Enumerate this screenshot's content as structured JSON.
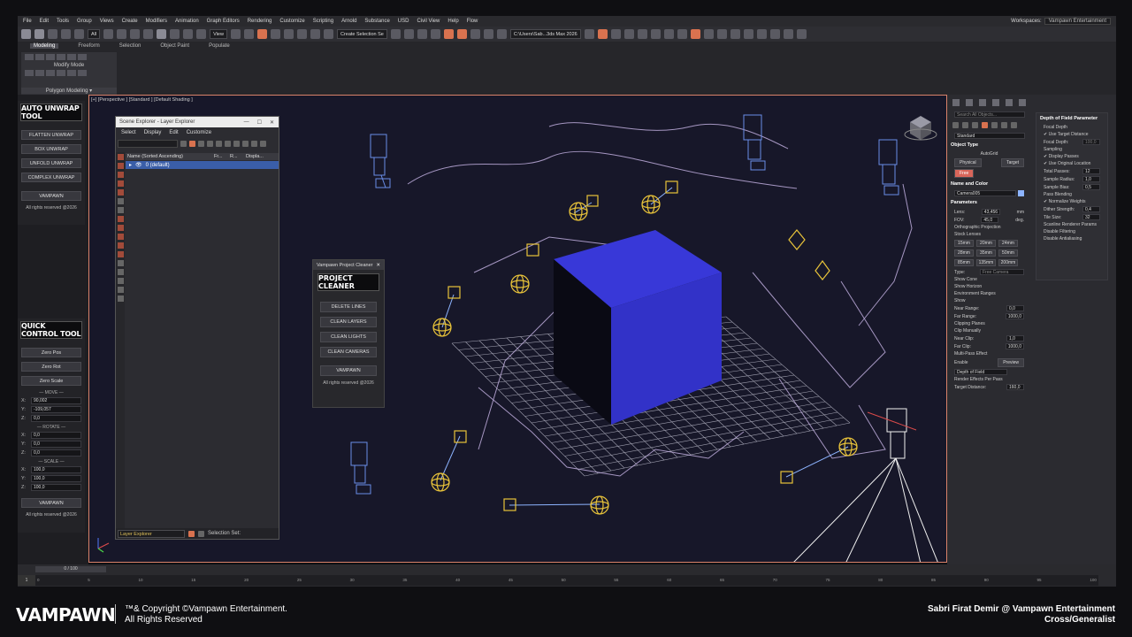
{
  "menubar": {
    "items": [
      "File",
      "Edit",
      "Tools",
      "Group",
      "Views",
      "Create",
      "Modifiers",
      "Animation",
      "Graph Editors",
      "Rendering",
      "Customize",
      "Scripting",
      "Arnold",
      "Substance",
      "USD",
      "Civil View",
      "Help",
      "Flow"
    ],
    "workspace_label": "Workspaces:",
    "workspace_value": "Vampawn Entertainment"
  },
  "toolbar": {
    "filter_value": "All",
    "view_value": "View",
    "selection_set_placeholder": "Create Selection Se",
    "path_value": "C:\\Users\\Sab...3ds Max 2026"
  },
  "ribbon": {
    "tabs": [
      "Modeling",
      "Freeform",
      "Selection",
      "Object Paint",
      "Populate"
    ],
    "modify_mode": "Modify Mode",
    "polygon_modeling": "Polygon Modeling"
  },
  "auto_unwrap": {
    "title": "AUTO UNWRAP TOOL",
    "buttons": [
      "FLATTEN UNWRAP",
      "BOX UNWRAP",
      "UNFOLD UNWRAP",
      "COMPLEX UNWRAP"
    ],
    "brand_button": "VAMPAWN",
    "note": "All rights reserved @2026"
  },
  "quick_control": {
    "title": "QUICK CONTROL TOOL",
    "buttons": [
      "Zero Pos",
      "Zero Rot",
      "Zero Scale"
    ],
    "move_label": "MOVE",
    "move": {
      "x": "90,002",
      "y": "-109,057",
      "z": "0,0"
    },
    "rotate_label": "ROTATE",
    "rotate": {
      "x": "0,0",
      "y": "0,0",
      "z": "0,0"
    },
    "scale_label": "SCALE",
    "scale": {
      "x": "100,0",
      "y": "100,0",
      "z": "100,0"
    },
    "brand_button": "VAMPAWN",
    "note": "All rights reserved @2026",
    "axis_x": "X:",
    "axis_y": "Y:",
    "axis_z": "Z:"
  },
  "viewport": {
    "label": "[+] [Perspective ] [Standard ] [Default Shading ]"
  },
  "scene_explorer": {
    "title": "Scene Explorer - Layer Explorer",
    "menu": [
      "Select",
      "Display",
      "Edit",
      "Customize"
    ],
    "columns": [
      "Name (Sorted Ascending)",
      "Fr...",
      "R...",
      "Displa..."
    ],
    "row": "0 (default)",
    "bottom_dropdown": "Layer Explorer",
    "selection_set": "Selection Set:"
  },
  "project_cleaner": {
    "window_title": "Vampawn Project Cleaner",
    "title": "PROJECT CLEANER",
    "buttons": [
      "DELETE LINES",
      "CLEAN LAYERS",
      "CLEAN LIGHTS",
      "CLEAN CAMERAS"
    ],
    "brand_button": "VAMPAWN",
    "note": "All rights reserved @2026"
  },
  "command_panel": {
    "search_placeholder": "Search All Objects...",
    "category": "Standard",
    "object_type": "Object Type",
    "autogrid": "AutoGrid",
    "physical": "Physical",
    "target": "Target",
    "free": "Free",
    "name_and_color": "Name and Color",
    "name_value": "Camera005",
    "parameters": "Parameters",
    "lens_label": "Lens:",
    "lens_value": "43,456",
    "lens_unit": "mm",
    "fov_label": "FOV:",
    "fov_value": "45,0",
    "fov_unit": "deg.",
    "ortho": "Orthographic Projection",
    "stock_lenses": "Stock Lenses",
    "lenses": [
      "15mm",
      "20mm",
      "24mm",
      "28mm",
      "35mm",
      "50mm",
      "85mm",
      "135mm",
      "200mm"
    ],
    "type_label": "Type:",
    "type_value": "Free Camera",
    "show_cone": "Show Cone",
    "show_horizon": "Show Horizon",
    "env_ranges": "Environment Ranges",
    "show": "Show",
    "near_range_label": "Near Range:",
    "near_range": "0,0",
    "far_range_label": "Far Range:",
    "far_range": "1000,0",
    "clipping": "Clipping Planes",
    "clip_manually": "Clip Manually",
    "near_clip_label": "Near Clip:",
    "near_clip": "1,0",
    "far_clip_label": "Far Clip:",
    "far_clip": "1000,0",
    "multipass": "Multi-Pass Effect",
    "enable": "Enable",
    "preview": "Preview",
    "effect_value": "Depth of Field",
    "render_effects": "Render Effects Per Pass",
    "target_distance_label": "Target Distance:",
    "target_distance": "160,0"
  },
  "dof": {
    "title": "Depth of Field Parameter",
    "focal_depth": "Focal Depth",
    "use_target": "Use Target Distance",
    "focal_depth_label": "Focal Depth:",
    "focal_depth_value": "100,0",
    "sampling": "Sampling",
    "display_passes": "Display Passes",
    "use_original": "Use Original Location",
    "total_passes_label": "Total Passes:",
    "total_passes": "12",
    "sample_radius_label": "Sample Radius:",
    "sample_radius": "1,0",
    "sample_bias_label": "Sample Bias:",
    "sample_bias": "0,5",
    "pass_blending": "Pass Blending",
    "normalize": "Normalize Weights",
    "dither_label": "Dither Strength:",
    "dither": "0,4",
    "tile_size_label": "Tile Size:",
    "tile_size": "32",
    "scanline": "Scanline Renderer Params",
    "disable_filtering": "Disable Filtering",
    "disable_antialiasing": "Disable Antialiasing"
  },
  "timeline": {
    "slider": "0 / 100",
    "ticks": [
      "0",
      "5",
      "10",
      "15",
      "20",
      "25",
      "30",
      "35",
      "40",
      "45",
      "50",
      "55",
      "60",
      "65",
      "70",
      "75",
      "80",
      "85",
      "90",
      "95",
      "100"
    ]
  },
  "footer": {
    "logo": "VAMPAWN",
    "copyright_line1": "™& Copyright ©Vampawn Entertainment.",
    "copyright_line2": "All Rights Reserved",
    "credit_line1": "Sabri Firat Demir @ Vampawn Entertainment",
    "credit_line2": "Cross/Generalist"
  },
  "colors": {
    "accent": "#d9724f",
    "cube_front": "#3232c8",
    "cube_top": "#3838d8",
    "cube_left": "#0a0a14",
    "light_gizmo": "#e8c33a",
    "camera_wire": "#6a8ee8",
    "spline": "#c9b6e8"
  }
}
